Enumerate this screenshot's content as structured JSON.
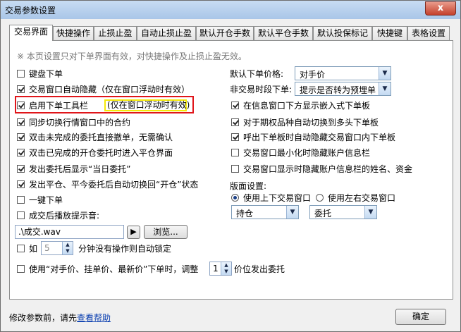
{
  "window": {
    "title": "交易参数设置",
    "close": "x"
  },
  "tabs": [
    {
      "label": "交易界面",
      "active": true
    },
    {
      "label": "快捷操作"
    },
    {
      "label": "止损止盈"
    },
    {
      "label": "自动止损止盈"
    },
    {
      "label": "默认开仓手数"
    },
    {
      "label": "默认平仓手数"
    },
    {
      "label": "默认投保标记"
    },
    {
      "label": "快捷键"
    },
    {
      "label": "表格设置"
    }
  ],
  "note": "※ 本页设置只对下单界面有效，对快捷操作及止损止盈无效。",
  "left_options": [
    {
      "label": "键盘下单",
      "checked": false
    },
    {
      "label": "交易窗口自动隐藏（仅在窗口浮动时有效）",
      "checked": true
    },
    {
      "label": "启用下单工具栏",
      "checked": true
    },
    {
      "label": "同步切换行情窗口中的合约",
      "checked": true
    },
    {
      "label": "双击未完成的委托直接撤单，无需确认",
      "checked": true
    },
    {
      "label": "双击已完成的开仓委托时进入平仓界面",
      "checked": true
    },
    {
      "label": "发出委托后显示“当日委托”",
      "checked": true
    },
    {
      "label": "发出平仓、平今委托后自动切换回“开仓”状态",
      "checked": true
    },
    {
      "label": "一键下单",
      "checked": false
    },
    {
      "label": "成交后播放提示音:",
      "checked": false
    }
  ],
  "toolbar_hint": "(仅在窗口浮动时有效)",
  "sound": {
    "file": ".\\成交.wav",
    "play": "▶",
    "browse": "浏览..."
  },
  "auto_lock": {
    "prefix": "如",
    "value": "5",
    "suffix": "分钟没有操作则自动锁定",
    "checked": false
  },
  "price_adjust": {
    "prefix": "使用“对手价、挂单价、最新价”下单时，调整",
    "value": "1",
    "suffix": "价位发出委托",
    "checked": false
  },
  "right": {
    "default_price_label": "默认下单价格:",
    "default_price_value": "对手价",
    "nontrading_label": "非交易时段下单:",
    "nontrading_value": "提示是否转为预埋单",
    "options": [
      {
        "label": "在信息窗口下方显示嵌入式下单板",
        "checked": true
      },
      {
        "label": "对于期权品种自动切换到多头下单板",
        "checked": true
      },
      {
        "label": "呼出下单板时自动隐藏交易窗口内下单板",
        "checked": true
      },
      {
        "label": "交易窗口最小化时隐藏账户信息栏",
        "checked": false
      },
      {
        "label": "交易窗口显示时隐藏账户信息栏的姓名、资金",
        "checked": false
      }
    ],
    "layout_label": "版面设置:",
    "radio_updown": "使用上下交易窗口",
    "radio_leftright": "使用左右交易窗口",
    "combo1": "持仓",
    "combo2": "委托"
  },
  "footer": {
    "text": "修改参数前，请先",
    "link": "查看帮助",
    "ok": "确定"
  }
}
